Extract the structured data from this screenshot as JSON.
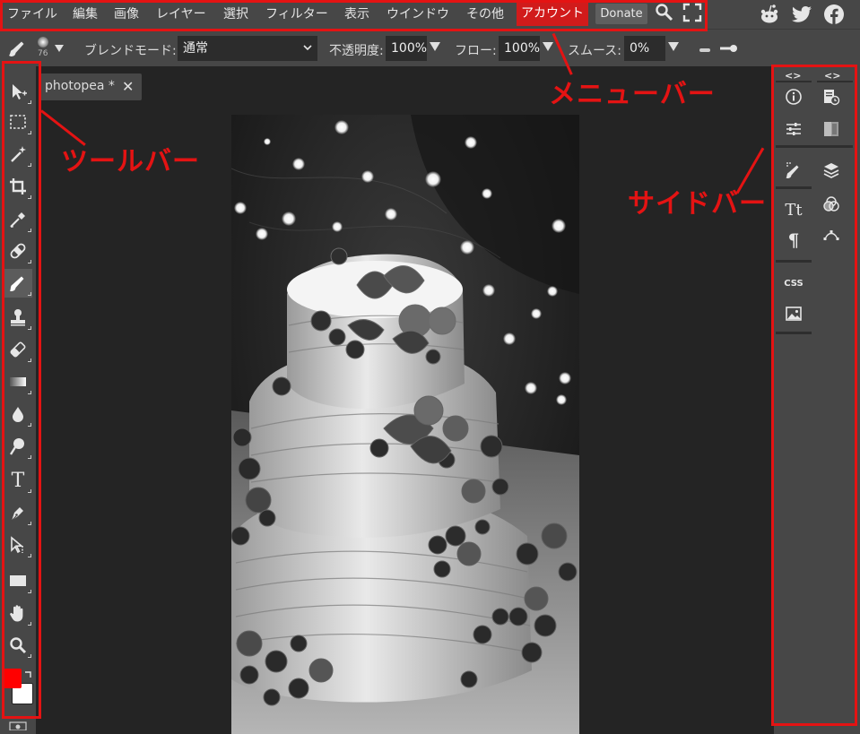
{
  "menubar": {
    "items": [
      "ファイル",
      "編集",
      "画像",
      "レイヤー",
      "選択",
      "フィルター",
      "表示",
      "ウインドウ",
      "その他"
    ],
    "account": "アカウント",
    "donate": "Donate"
  },
  "options": {
    "brush_size": "76",
    "blend_label": "ブレンドモード:",
    "blend_value": "通常",
    "opacity_label": "不透明度:",
    "opacity_value": "100%",
    "flow_label": "フロー:",
    "flow_value": "100%",
    "smooth_label": "スムース:",
    "smooth_value": "0%"
  },
  "document": {
    "tab_title": "photopea *",
    "close_glyph": "✕"
  },
  "toolbar": {
    "type_tool_glyph": "T",
    "tools": [
      "move-tool",
      "marquee-tool",
      "magic-wand-tool",
      "crop-tool",
      "eyedropper-tool",
      "healing-tool",
      "brush-tool",
      "stamp-tool",
      "eraser-tool",
      "gradient-tool",
      "blur-tool",
      "dodge-tool",
      "type-tool",
      "pen-tool",
      "path-select-tool",
      "shape-tool",
      "hand-tool",
      "zoom-tool"
    ],
    "active_tool": "brush-tool",
    "foreground_color": "#ff0000",
    "background_color": "#ffffff"
  },
  "sidebar": {
    "collapse_glyph": "<>",
    "character_glyph": "Tt",
    "paragraph_glyph": "¶",
    "css_label": "CSS"
  },
  "annotations": {
    "menubar": "メニューバー",
    "toolbar": "ツールバー",
    "sidebar": "サイドバー",
    "color": "#e41313"
  }
}
